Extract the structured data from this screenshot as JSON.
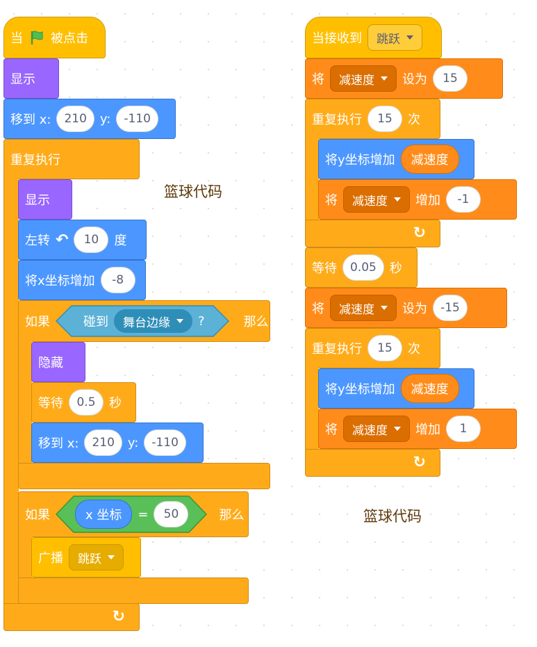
{
  "left_script": {
    "when_flag_clicked": {
      "pre": "当",
      "post": "被点击"
    },
    "show_1": "显示",
    "goto_1": {
      "label": "移到 x:",
      "x": "210",
      "y_label": "y:",
      "y": "-110"
    },
    "forever": "重复执行",
    "show_2": "显示",
    "turn_left": {
      "label": "左转",
      "value": "10",
      "unit": "度"
    },
    "change_x": {
      "label": "将x坐标增加",
      "value": "-8"
    },
    "if_1": {
      "label": "如果",
      "touching": "碰到",
      "target": "舞台边缘",
      "q": "?",
      "then": "那么"
    },
    "hide": "隐藏",
    "wait": {
      "label": "等待",
      "value": "0.5",
      "unit": "秒"
    },
    "goto_2": {
      "label": "移到 x:",
      "x": "210",
      "y_label": "y:",
      "y": "-110"
    },
    "if_2": {
      "label": "如果",
      "reporter": "x 坐标",
      "op": "=",
      "value": "50",
      "then": "那么"
    },
    "broadcast": {
      "label": "广播",
      "message": "跳跃"
    }
  },
  "right_script": {
    "when_receive": {
      "label": "当接收到",
      "message": "跳跃"
    },
    "set_1": {
      "label": "将",
      "var": "减速度",
      "to": "设为",
      "value": "15"
    },
    "repeat_1": {
      "label": "重复执行",
      "count": "15",
      "times": "次"
    },
    "change_y_1": {
      "label": "将y坐标增加",
      "var": "减速度"
    },
    "change_var_1": {
      "label": "将",
      "var": "减速度",
      "by": "增加",
      "value": "-1"
    },
    "wait": {
      "label": "等待",
      "value": "0.05",
      "unit": "秒"
    },
    "set_2": {
      "label": "将",
      "var": "减速度",
      "to": "设为",
      "value": "-15"
    },
    "repeat_2": {
      "label": "重复执行",
      "count": "15",
      "times": "次"
    },
    "change_y_2": {
      "label": "将y坐标增加",
      "var": "减速度"
    },
    "change_var_2": {
      "label": "将",
      "var": "减速度",
      "by": "增加",
      "value": "1"
    }
  },
  "notes": {
    "left": "篮球代码",
    "right": "篮球代码"
  },
  "colors": {
    "events": "#ffbf00",
    "looks": "#9966ff",
    "motion": "#4c97ff",
    "control": "#ffab19",
    "variables": "#ff8c1a",
    "operators": "#59c059",
    "sensing": "#5cb1d6"
  },
  "icons": {
    "flag": "green-flag-icon",
    "turn": "rotate-left-icon",
    "loop": "loop-arrow-icon",
    "caret": "dropdown-caret-icon"
  }
}
